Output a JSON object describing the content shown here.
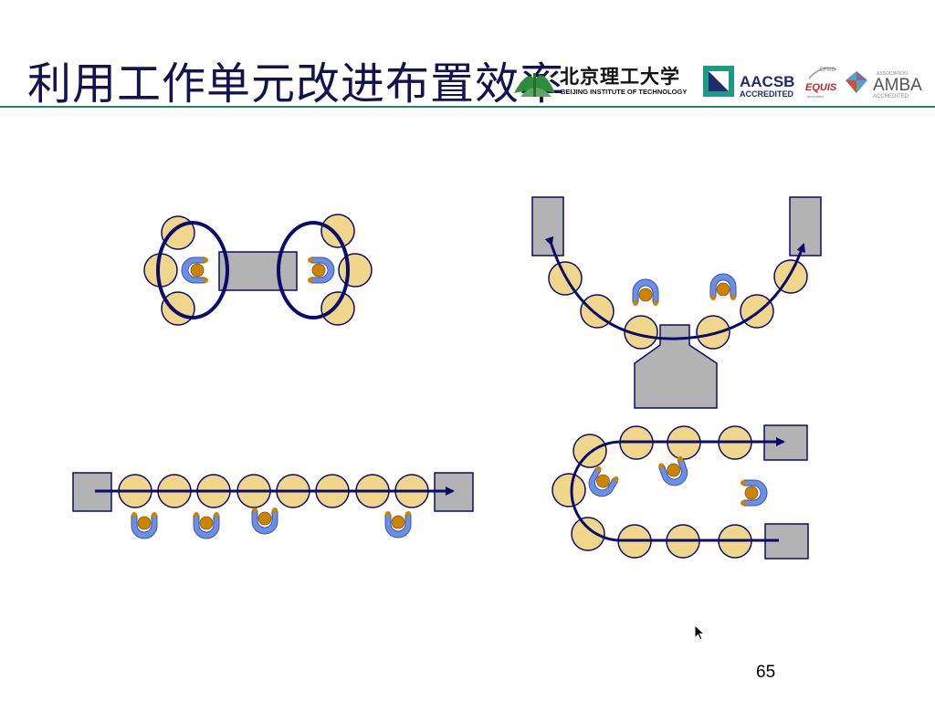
{
  "slide": {
    "title": "利用工作单元改进布置效率",
    "page_number": "65"
  },
  "logos": {
    "school_cn": "北京理工大学",
    "school_en": "BEIJING INSTITUTE OF TECHNOLOGY",
    "aacsb": "AACSB",
    "aacsb_sub": "ACCREDITED",
    "efmd": "EFMD",
    "equis": "EQUIS",
    "equis_sub": "accredited",
    "amba_assoc": "ASSOCIATION",
    "amba": "AMBA",
    "amba_sub": "ACCREDITED"
  },
  "colors": {
    "title": "#13134e",
    "rule": "#1f8a57",
    "station_fill": "#f0d68a",
    "machine_fill": "#b3b3b3",
    "flow_line": "#0b0b6b",
    "worker_body": "#6b8ee6",
    "worker_head": "#cc8400"
  },
  "icons": [
    "bit-logo-icon",
    "aacsb-logo-icon",
    "equis-logo-icon",
    "amba-logo-icon",
    "arrow-cursor-icon"
  ]
}
